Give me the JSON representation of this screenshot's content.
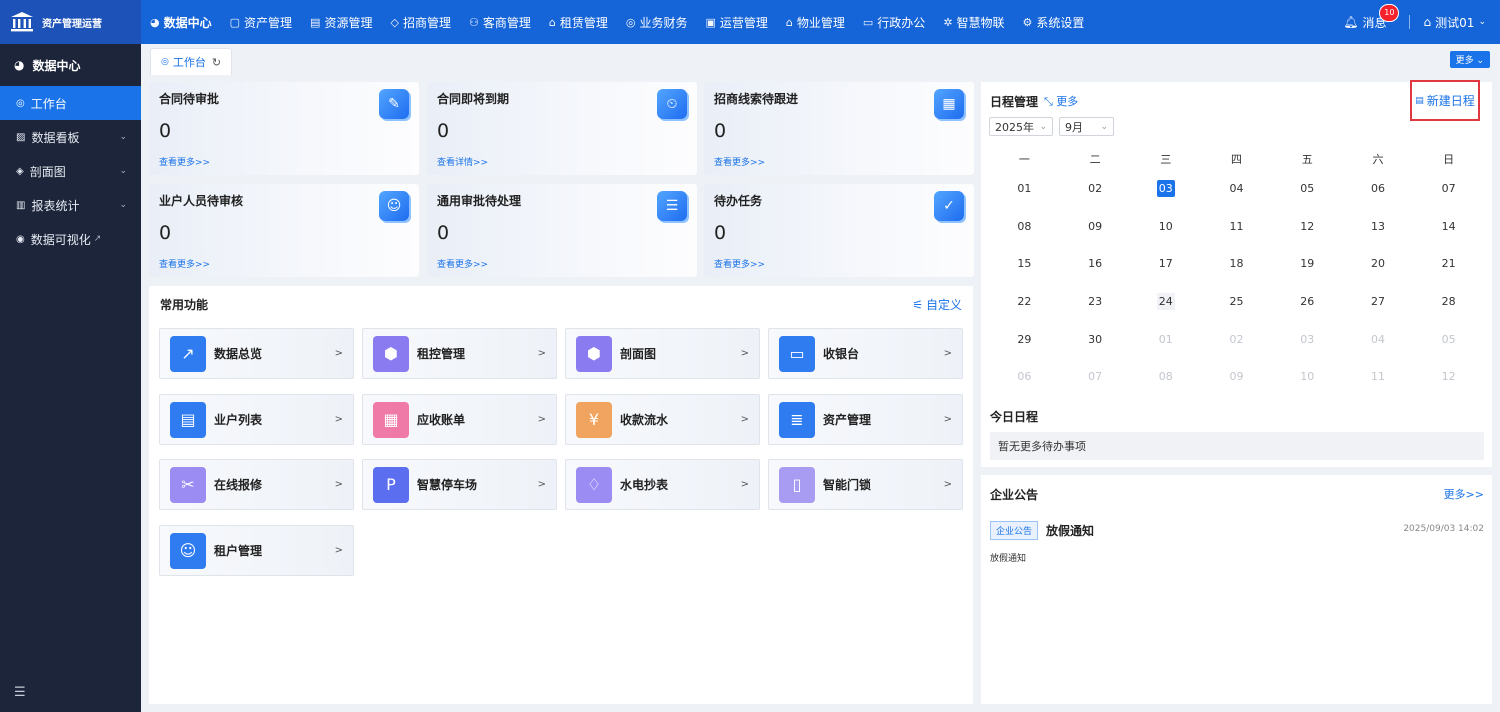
{
  "app": {
    "title": "资产管理运营"
  },
  "topnav": {
    "items": [
      {
        "label": "数据中心",
        "icon": "pie-chart-icon",
        "glyph": "◕"
      },
      {
        "label": "资产管理",
        "icon": "cube-icon",
        "glyph": "▢"
      },
      {
        "label": "资源管理",
        "icon": "document-icon",
        "glyph": "▤"
      },
      {
        "label": "招商管理",
        "icon": "tag-icon",
        "glyph": "◇"
      },
      {
        "label": "客商管理",
        "icon": "users-icon",
        "glyph": "⚇"
      },
      {
        "label": "租赁管理",
        "icon": "building-icon",
        "glyph": "⌂"
      },
      {
        "label": "业务财务",
        "icon": "coin-icon",
        "glyph": "◎"
      },
      {
        "label": "运营管理",
        "icon": "grid-icon",
        "glyph": "▣"
      },
      {
        "label": "物业管理",
        "icon": "home-icon",
        "glyph": "⌂"
      },
      {
        "label": "行政办公",
        "icon": "monitor-icon",
        "glyph": "▭"
      },
      {
        "label": "智慧物联",
        "icon": "iot-icon",
        "glyph": "✲"
      },
      {
        "label": "系统设置",
        "icon": "gear-icon",
        "glyph": "⚙"
      }
    ],
    "messages_label": "消息",
    "messages_count": "10",
    "user_label": "测试01"
  },
  "sidebar": {
    "header": "数据中心",
    "items": [
      {
        "label": "工作台",
        "glyph": "◎",
        "chevron": ""
      },
      {
        "label": "数据看板",
        "glyph": "▨",
        "chevron": "⌄"
      },
      {
        "label": "剖面图",
        "glyph": "◈",
        "chevron": "⌄"
      },
      {
        "label": "报表统计",
        "glyph": "▥",
        "chevron": "⌄"
      },
      {
        "label": "数据可视化",
        "glyph": "◉",
        "chevron": ""
      }
    ],
    "external_glyph": "↗",
    "collapse_glyph": "☰"
  },
  "tabs": {
    "active": "工作台",
    "more": "更多 ⌄"
  },
  "stats": [
    {
      "title": "合同待审批",
      "count": "0",
      "link": "查看更多>>",
      "icon": "contract-approve-icon",
      "glyph": "✎"
    },
    {
      "title": "合同即将到期",
      "count": "0",
      "link": "查看详情>>",
      "icon": "contract-expire-icon",
      "glyph": "⏲"
    },
    {
      "title": "招商线索待跟进",
      "count": "0",
      "link": "查看更多>>",
      "icon": "lead-icon",
      "glyph": "▦"
    },
    {
      "title": "业户人员待审核",
      "count": "0",
      "link": "查看更多>>",
      "icon": "user-review-icon",
      "glyph": "☺"
    },
    {
      "title": "通用审批待处理",
      "count": "0",
      "link": "查看更多>>",
      "icon": "approval-list-icon",
      "glyph": "☰"
    },
    {
      "title": "待办任务",
      "count": "0",
      "link": "查看更多>>",
      "icon": "calendar-task-icon",
      "glyph": "✓"
    }
  ],
  "functions": {
    "title": "常用功能",
    "custom": "自定义",
    "items": [
      {
        "label": "数据总览",
        "icon": "chart-trend-icon",
        "glyph": "↗",
        "color": "#2f7bf0"
      },
      {
        "label": "租控管理",
        "icon": "box-icon",
        "glyph": "⬢",
        "color": "#8a7cf0"
      },
      {
        "label": "剖面图",
        "icon": "box-icon",
        "glyph": "⬢",
        "color": "#8a7cf0"
      },
      {
        "label": "收银台",
        "icon": "cashier-icon",
        "glyph": "▭",
        "color": "#2f7bf0"
      },
      {
        "label": "业户列表",
        "icon": "clipboard-icon",
        "glyph": "▤",
        "color": "#2f7bf0"
      },
      {
        "label": "应收账单",
        "icon": "bill-icon",
        "glyph": "▦",
        "color": "#f07aa7"
      },
      {
        "label": "收款流水",
        "icon": "money-bag-icon",
        "glyph": "¥",
        "color": "#f0a460"
      },
      {
        "label": "资产管理",
        "icon": "database-icon",
        "glyph": "≣",
        "color": "#2f7bf0"
      },
      {
        "label": "在线报修",
        "icon": "wrench-icon",
        "glyph": "✂",
        "color": "#9a8cf2"
      },
      {
        "label": "智慧停车场",
        "icon": "parking-icon",
        "glyph": "P",
        "color": "#5b6ef0"
      },
      {
        "label": "水电抄表",
        "icon": "water-drop-icon",
        "glyph": "♢",
        "color": "#9a8cf2"
      },
      {
        "label": "智能门锁",
        "icon": "door-lock-icon",
        "glyph": "▯",
        "color": "#a89cf2"
      },
      {
        "label": "租户管理",
        "icon": "tenant-icon",
        "glyph": "☺",
        "color": "#2f7bf0"
      }
    ],
    "arrow": ">"
  },
  "schedule": {
    "title": "日程管理",
    "more": "⤡ 更多",
    "new_button": "新建日程",
    "year": "2025年",
    "month": "9月",
    "weekdays": [
      "一",
      "二",
      "三",
      "四",
      "五",
      "六",
      "日"
    ],
    "weeks": [
      [
        "01",
        "02",
        "03",
        "04",
        "05",
        "06",
        "07"
      ],
      [
        "08",
        "09",
        "10",
        "11",
        "12",
        "13",
        "14"
      ],
      [
        "15",
        "16",
        "17",
        "18",
        "19",
        "20",
        "21"
      ],
      [
        "22",
        "23",
        "24",
        "25",
        "26",
        "27",
        "28"
      ],
      [
        "29",
        "30",
        "01",
        "02",
        "03",
        "04",
        "05"
      ],
      [
        "06",
        "07",
        "08",
        "09",
        "10",
        "11",
        "12"
      ]
    ],
    "today_title": "今日日程",
    "today_empty": "暂无更多待办事项"
  },
  "notice": {
    "title": "企业公告",
    "more": "更多>>",
    "tag": "企业公告",
    "item_title": "放假通知",
    "item_time": "2025/09/03 14:02",
    "item_desc": "放假通知"
  }
}
